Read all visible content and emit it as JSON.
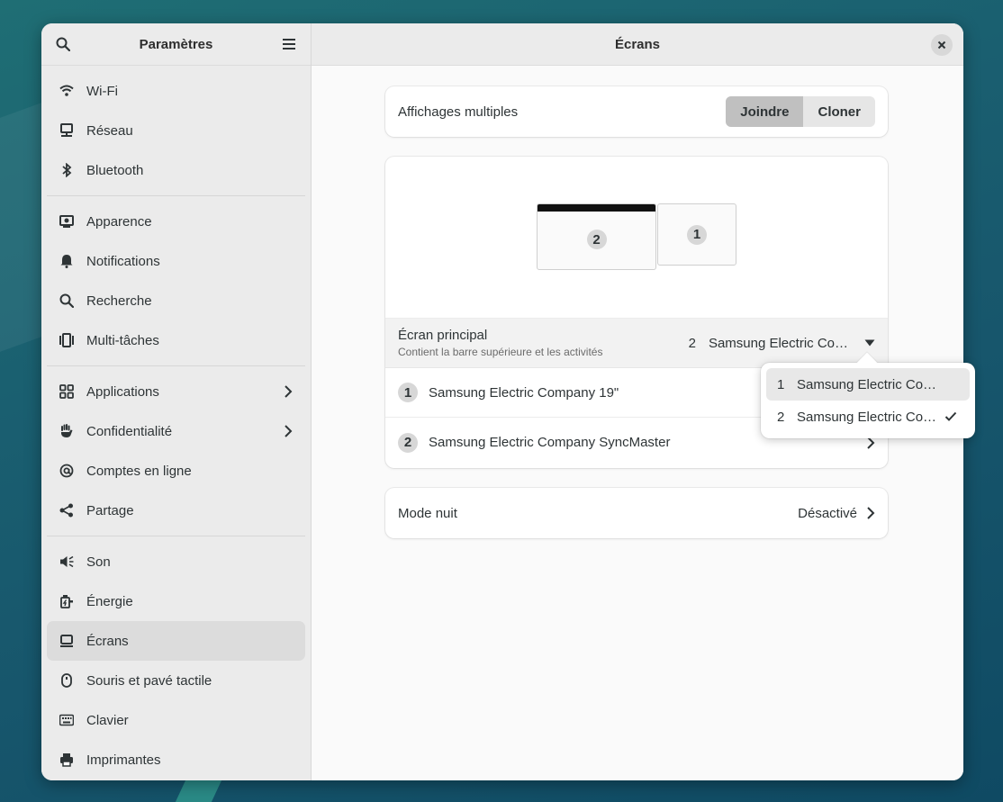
{
  "sidebar": {
    "title": "Paramètres",
    "items": [
      {
        "label": "Wi-Fi",
        "icon": "wifi-icon"
      },
      {
        "label": "Réseau",
        "icon": "network-icon"
      },
      {
        "label": "Bluetooth",
        "icon": "bluetooth-icon"
      },
      {
        "label": "Apparence",
        "icon": "appearance-icon"
      },
      {
        "label": "Notifications",
        "icon": "bell-icon"
      },
      {
        "label": "Recherche",
        "icon": "search-icon"
      },
      {
        "label": "Multi-tâches",
        "icon": "multitasking-icon"
      },
      {
        "label": "Applications",
        "icon": "grid-icon"
      },
      {
        "label": "Confidentialité",
        "icon": "hand-icon"
      },
      {
        "label": "Comptes en ligne",
        "icon": "at-icon"
      },
      {
        "label": "Partage",
        "icon": "share-icon"
      },
      {
        "label": "Son",
        "icon": "speaker-icon"
      },
      {
        "label": "Énergie",
        "icon": "power-icon"
      },
      {
        "label": "Écrans",
        "icon": "display-icon"
      },
      {
        "label": "Souris et pavé tactile",
        "icon": "mouse-icon"
      },
      {
        "label": "Clavier",
        "icon": "keyboard-icon"
      },
      {
        "label": "Imprimantes",
        "icon": "printer-icon"
      }
    ],
    "active": "Écrans"
  },
  "main": {
    "title": "Écrans",
    "multi_display": {
      "label": "Affichages multiples",
      "options": [
        "Joindre",
        "Cloner"
      ],
      "selected": "Joindre"
    },
    "arrangement": {
      "monitor_a": "2",
      "monitor_b": "1"
    },
    "primary": {
      "label": "Écran principal",
      "description": "Contient la barre supérieure et les activités",
      "value_num": "2",
      "value_name": "Samsung Electric Co…"
    },
    "monitors": [
      {
        "num": "1",
        "name": "Samsung Electric Company 19\""
      },
      {
        "num": "2",
        "name": "Samsung Electric Company SyncMaster"
      }
    ],
    "night_mode": {
      "label": "Mode nuit",
      "value": "Désactivé"
    }
  },
  "popover": {
    "items": [
      {
        "num": "1",
        "name": "Samsung Electric Co…"
      },
      {
        "num": "2",
        "name": "Samsung Electric Co…"
      }
    ],
    "checked": "2"
  }
}
